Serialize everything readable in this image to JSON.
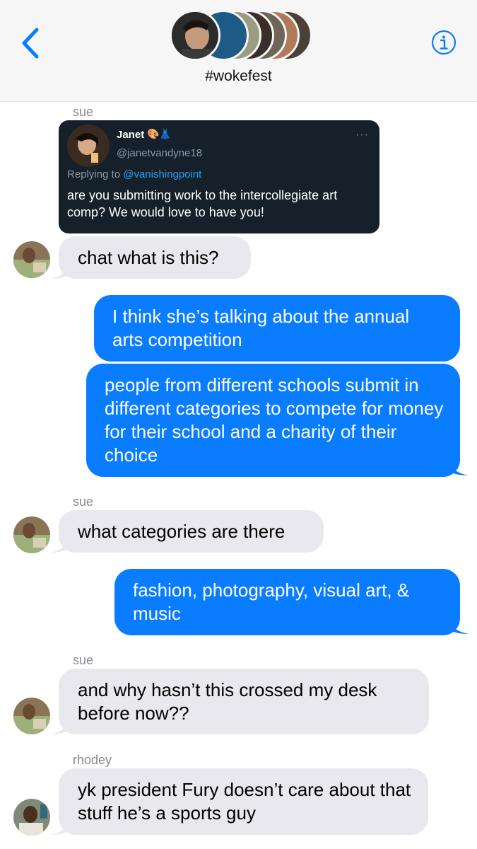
{
  "header": {
    "title": "#wokefest",
    "back_icon": "chevron-left-icon",
    "info_icon": "info-circle-icon",
    "accent": "#0a7cff"
  },
  "tweet": {
    "name": "Janet",
    "emoji": "🎨👗",
    "handle": "@janetvandyne18",
    "replying_prefix": "Replying to ",
    "replying_to": "@vanishingpoint",
    "body": "are you submitting work to the intercollegiate art comp? We would love to have you!",
    "more_icon": "···"
  },
  "messages": [
    {
      "sender": "sue",
      "text": "chat what is this?"
    },
    {
      "text": "I think she’s talking about the annual arts competition"
    },
    {
      "text": "people from different schools submit in different categories to compete for money for their school and a charity of their choice"
    },
    {
      "sender": "sue",
      "text": "what categories are there"
    },
    {
      "text": "fashion, photography, visual art, & music"
    },
    {
      "sender": "sue",
      "text": "and why hasn’t this crossed my desk before now??"
    },
    {
      "sender": "rhodey",
      "text": "yk president Fury doesn’t care about that stuff he’s a sports guy"
    }
  ],
  "colors": {
    "incoming_bubble": "#e9e8ee",
    "outgoing_bubble": "#0a7cff",
    "tweet_bg": "#15202b"
  }
}
